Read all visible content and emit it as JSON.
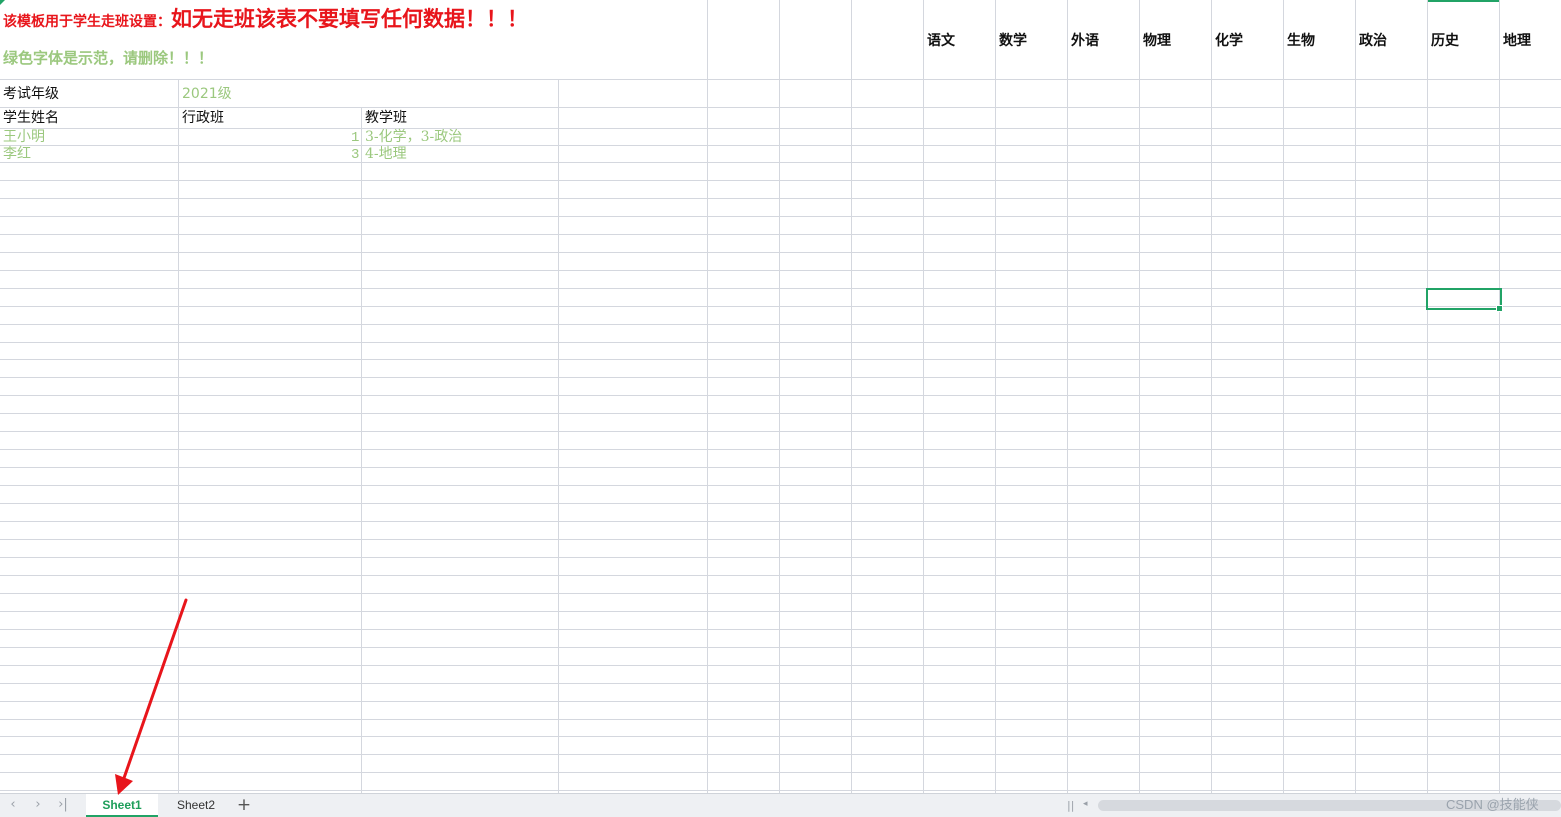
{
  "notice": {
    "part1": "该模板用于学生走班设置：",
    "part2": "如无走班该表不要填写任何数据！！！",
    "green_hint": "绿色字体是示范，请删除！！！"
  },
  "subjects": [
    "语文",
    "数学",
    "外语",
    "物理",
    "化学",
    "生物",
    "政治",
    "历史",
    "地理"
  ],
  "exam_grade": {
    "label": "考试年级",
    "value": "2021级"
  },
  "table_header": {
    "name": "学生姓名",
    "admin_class": "行政班",
    "teaching_class": "教学班"
  },
  "rows": [
    {
      "name": "王小明",
      "admin_class": "1",
      "teaching_class": "3-化学，3-政治"
    },
    {
      "name": "李红",
      "admin_class": "3",
      "teaching_class": "4-地理"
    }
  ],
  "sheet_tabs": [
    "Sheet1",
    "Sheet2"
  ],
  "active_sheet": "Sheet1",
  "watermark": "CSDN @技能侠",
  "colors": {
    "demo_green": "#9bc87e",
    "warning_red": "#e8151b",
    "accent": "#21a366",
    "annotation_arrow": "#e8151b"
  }
}
